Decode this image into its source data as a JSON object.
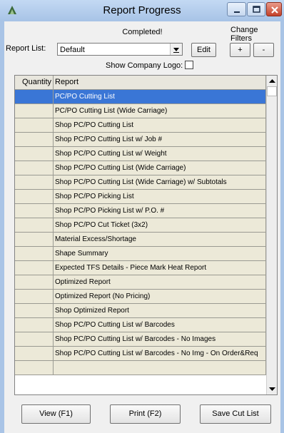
{
  "window": {
    "title": "Report Progress",
    "controls": {
      "minimize": "minimize-icon",
      "maximize": "maximize-icon",
      "close": "close-icon"
    }
  },
  "status": "Completed!",
  "change_filters": "Change Filters",
  "report_list": {
    "label": "Report List:",
    "selected": "Default",
    "edit_label": "Edit",
    "add_label": "+",
    "remove_label": "-"
  },
  "show_logo": {
    "label": "Show Company Logo:",
    "checked": false
  },
  "grid": {
    "headers": {
      "quantity": "Quantity",
      "report": "Report"
    },
    "selected_index": 0,
    "rows": [
      {
        "quantity": "",
        "report": "PC/PO Cutting List"
      },
      {
        "quantity": "",
        "report": "PC/PO Cutting List (Wide Carriage)"
      },
      {
        "quantity": "",
        "report": "Shop PC/PO Cutting List"
      },
      {
        "quantity": "",
        "report": "Shop PC/PO Cutting List w/ Job #"
      },
      {
        "quantity": "",
        "report": "Shop PC/PO Cutting List w/ Weight"
      },
      {
        "quantity": "",
        "report": "Shop PC/PO Cutting List (Wide Carriage)"
      },
      {
        "quantity": "",
        "report": "Shop PC/PO Cutting List (Wide Carriage) w/ Subtotals"
      },
      {
        "quantity": "",
        "report": "Shop PC/PO Picking List"
      },
      {
        "quantity": "",
        "report": "Shop PC/PO Picking List w/ P.O. #"
      },
      {
        "quantity": "",
        "report": "Shop PC/PO Cut Ticket (3x2)"
      },
      {
        "quantity": "",
        "report": "Material Excess/Shortage"
      },
      {
        "quantity": "",
        "report": "Shape Summary"
      },
      {
        "quantity": "",
        "report": "Expected TFS Details - Piece Mark Heat Report"
      },
      {
        "quantity": "",
        "report": "Optimized Report"
      },
      {
        "quantity": "",
        "report": "Optimized Report (No Pricing)"
      },
      {
        "quantity": "",
        "report": "Shop Optimized Report"
      },
      {
        "quantity": "",
        "report": "Shop PC/PO Cutting List w/ Barcodes"
      },
      {
        "quantity": "",
        "report": "Shop PC/PO Cutting List w/ Barcodes - No Images"
      },
      {
        "quantity": "",
        "report": "Shop PC/PO Cutting List w/ Barcodes - No Img - On Order&Req"
      },
      {
        "quantity": "",
        "report": ""
      }
    ]
  },
  "footer": {
    "view_label": "View (F1)",
    "print_label": "Print (F2)",
    "save_label": "Save Cut List"
  },
  "colors": {
    "selection": "#3a76d6",
    "row_bg": "#ece9d8",
    "titlebar": "#b3cdee"
  }
}
